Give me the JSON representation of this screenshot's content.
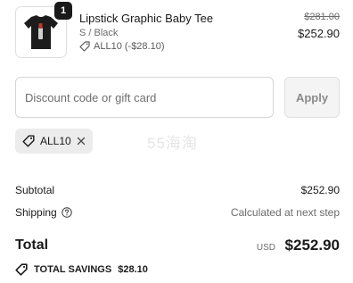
{
  "product": {
    "quantity": "1",
    "name": "Lipstick Graphic Baby Tee",
    "variant": "S / Black",
    "discount_label": "ALL10 (-$28.10)",
    "original_price": "$281.00",
    "price": "$252.90",
    "thumbnail_icon": "black-tee-lipstick-graphic"
  },
  "discount": {
    "placeholder": "Discount code or gift card",
    "value": "",
    "apply_label": "Apply"
  },
  "applied_code": {
    "code": "ALL10"
  },
  "watermark": "55海淘",
  "summary": {
    "subtotal_label": "Subtotal",
    "subtotal_value": "$252.90",
    "shipping_label": "Shipping",
    "shipping_value": "Calculated at next step"
  },
  "total": {
    "label": "Total",
    "currency": "USD",
    "value": "$252.90"
  },
  "savings": {
    "label": "TOTAL SAVINGS",
    "value": "$28.10"
  },
  "colors": {
    "text": "#1a1a1a",
    "muted": "#6b6b6b",
    "badge": "#1a1a1a",
    "chip_bg": "#ececec"
  }
}
